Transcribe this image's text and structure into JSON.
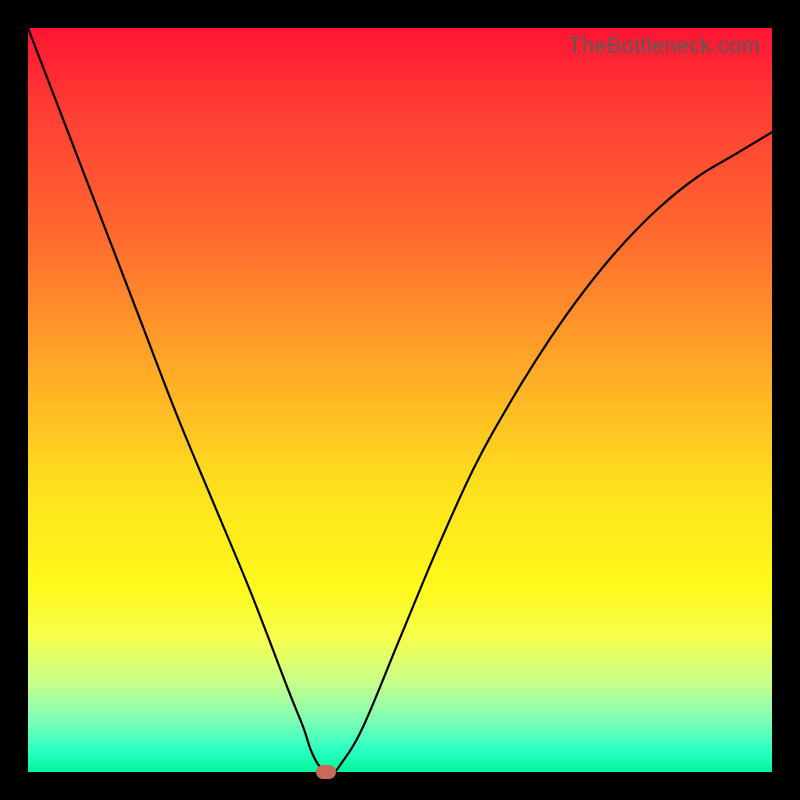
{
  "watermark": "TheBottleneck.com",
  "colors": {
    "frame": "#000000",
    "curve": "#000000",
    "marker": "#c86a5a"
  },
  "chart_data": {
    "type": "line",
    "title": "",
    "xlabel": "",
    "ylabel": "",
    "xlim": [
      0,
      100
    ],
    "ylim": [
      0,
      100
    ],
    "grid": false,
    "legend": false,
    "annotations": [
      "TheBottleneck.com"
    ],
    "series": [
      {
        "name": "bottleneck-curve",
        "x": [
          0,
          5,
          10,
          15,
          20,
          25,
          30,
          35,
          37,
          38,
          39,
          40,
          41,
          42,
          45,
          50,
          55,
          60,
          65,
          70,
          75,
          80,
          85,
          90,
          95,
          100
        ],
        "y": [
          100,
          87,
          74,
          61,
          48,
          36,
          24,
          11,
          6,
          3,
          1,
          0,
          0,
          1,
          6,
          18,
          30,
          41,
          50,
          58,
          65,
          71,
          76,
          80,
          83,
          86
        ]
      }
    ],
    "marker": {
      "x": 40,
      "y": 0
    },
    "background_gradient": {
      "orientation": "vertical",
      "stops": [
        {
          "pos": 0.0,
          "color": "#ff1433"
        },
        {
          "pos": 0.28,
          "color": "#ff6a2f"
        },
        {
          "pos": 0.62,
          "color": "#ffe11e"
        },
        {
          "pos": 0.88,
          "color": "#c8ff8a"
        },
        {
          "pos": 1.0,
          "color": "#00f59d"
        }
      ]
    }
  }
}
